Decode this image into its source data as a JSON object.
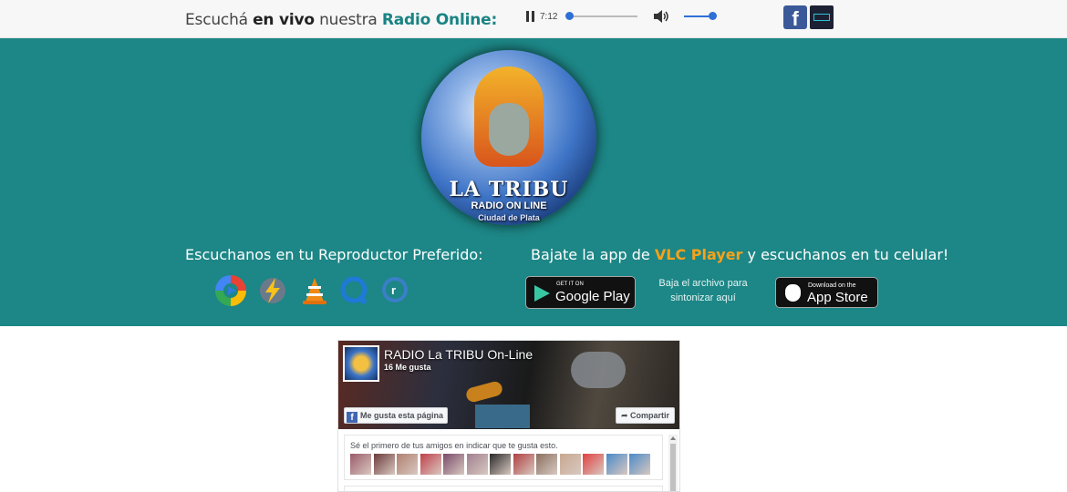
{
  "header": {
    "tagline_pre": "Escuchá ",
    "tagline_bold": "en vivo",
    "tagline_mid": " nuestra ",
    "tagline_accent": "Radio Online:",
    "player": {
      "time": "7:12",
      "progress": 0.0,
      "volume": 1.0
    },
    "social": [
      {
        "name": "facebook-icon",
        "glyph": "f",
        "color": "#3b5998"
      },
      {
        "name": "radio-app-icon",
        "color": "#1c2233"
      }
    ]
  },
  "band": {
    "color": "#1d8686",
    "logo": {
      "title": "LA TRIBU",
      "subtitle": "RADIO ON LINE",
      "city": "Ciudad de Plata"
    },
    "listen_title": "Escuchanos en tu Reproductor Preferido:",
    "players": [
      "windows-media-player-icon",
      "winamp-icon",
      "vlc-icon",
      "quicktime-icon",
      "realplayer-icon"
    ],
    "app_title_pre": "Bajate la app de ",
    "app_title_vlc": "VLC Player",
    "app_title_post": " y escuchanos en tu celular!",
    "google_play": {
      "small": "GET IT ON",
      "big": "Google Play"
    },
    "file_note": "Baja el archivo para sintonizar aquí",
    "app_store": {
      "small": "Download on the",
      "big": "App Store"
    }
  },
  "facebook": {
    "page_name": "RADIO La TRIBU On-Line",
    "likes": "16 Me gusta",
    "like_button": "Me gusta esta página",
    "share_button": "Compartir",
    "friends_message": "Sé el primero de tus amigos en indicar que te gusta esto.",
    "face_colors": [
      "#9b5a6a",
      "#6c3b3b",
      "#b08070",
      "#c0404a",
      "#7a4a6a",
      "#a08090",
      "#2a2a2a",
      "#b04040",
      "#8a7060",
      "#c8a890",
      "#e04040",
      "#4a8ac8",
      "#4a8ac8"
    ]
  }
}
